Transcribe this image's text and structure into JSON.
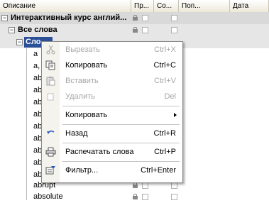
{
  "header": {
    "columns": [
      "Описание",
      "Пр...",
      "Со...",
      "Поп...",
      "Дата"
    ]
  },
  "tree": {
    "root_label": "Интерактивный курс англий...",
    "group_label": "Все слова",
    "selected_label": "Сло",
    "words": [
      "a",
      "a,",
      "ab",
      "ab",
      "ab",
      "ab",
      "ab",
      "ab",
      "ab",
      "ab",
      "ab",
      "ab",
      "abrupt",
      "absolute"
    ]
  },
  "menu": {
    "items": [
      {
        "label": "Вырезать",
        "shortcut": "Ctrl+X",
        "disabled": true,
        "icon": "scissors-icon"
      },
      {
        "label": "Копировать",
        "shortcut": "Ctrl+C",
        "disabled": false,
        "icon": "copy-icon"
      },
      {
        "label": "Вставить",
        "shortcut": "Ctrl+V",
        "disabled": true,
        "icon": "paste-icon"
      },
      {
        "label": "Удалить",
        "shortcut": "Del",
        "disabled": true,
        "icon": "delete-icon"
      },
      {
        "label": "Копировать",
        "shortcut": "",
        "disabled": false,
        "icon": "",
        "submenu": true
      },
      {
        "label": "Назад",
        "shortcut": "Ctrl+R",
        "disabled": false,
        "icon": "back-arrow-icon"
      },
      {
        "label": "Распечатать слова",
        "shortcut": "Ctrl+P",
        "disabled": false,
        "icon": "printer-icon"
      },
      {
        "label": "Фильтр...",
        "shortcut": "Ctrl+Enter",
        "disabled": false,
        "icon": "filter-icon"
      }
    ]
  }
}
